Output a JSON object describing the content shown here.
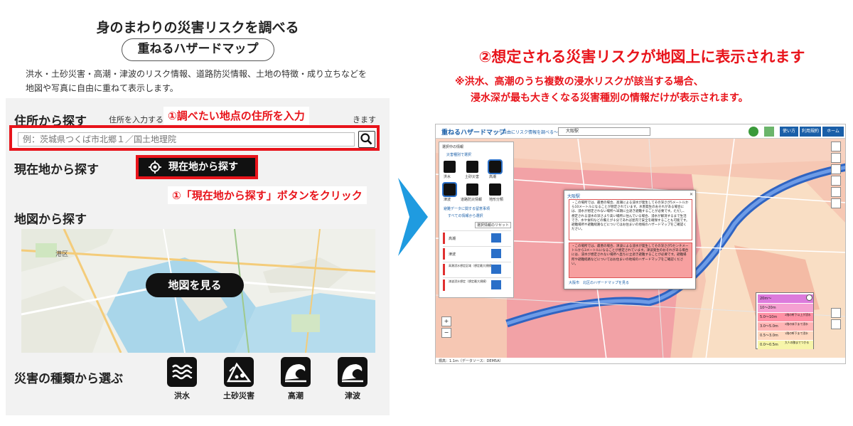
{
  "left": {
    "title": "身のまわりの災害リスクを調べる",
    "pill_label": "重ねるハザードマップ",
    "description": "洪水・土砂災害・高潮・津波のリスク情報、道路防災情報、土地の特徴・成り立ちなどを地図や写真に自由に重ねて表示します。",
    "search_section": {
      "heading": "住所から探す",
      "hint_prefix": "住所を入力する",
      "hint_suffix": "きます",
      "annotation": "①調べたい地点の住所を入力",
      "placeholder": "例：茨城県つくば市北郷１／国土地理院"
    },
    "current_section": {
      "heading": "現在地から探す",
      "button_label": "現在地から探す",
      "annotation": "①「現在地から探す」ボタンをクリック"
    },
    "map_section": {
      "heading": "地図から探す",
      "button_label": "地図を見る",
      "map_labels": {
        "a": "港区"
      }
    },
    "hazard_section": {
      "heading": "災害の種類から選ぶ",
      "items": [
        {
          "label": "洪水",
          "icon": "flood-icon"
        },
        {
          "label": "土砂災害",
          "icon": "landslide-icon"
        },
        {
          "label": "高潮",
          "icon": "storm-surge-icon"
        },
        {
          "label": "津波",
          "icon": "tsunami-icon"
        }
      ]
    }
  },
  "right": {
    "title": "②想定される災害リスクが地図上に表示されます",
    "note_line1": "※洪水、高潮のうち複数の浸水リスクが該当する場合、",
    "note_line2": "浸水深が最も大きくなる災害種別の情報だけが表示されます。",
    "screenshot": {
      "logo": "重ねるハザードマップ",
      "tagline": "～自由にリスク情報を調べる～",
      "search_value": "大阪駅",
      "header_buttons": [
        "使い方",
        "利用規約",
        "ホーム"
      ],
      "side": {
        "title": "選択中の情報",
        "type_select": "災害種別で選択",
        "hazards": [
          "洪水",
          "土砂災害",
          "高潮",
          "津波",
          "道路防災情報",
          "地形分類"
        ],
        "link1": "避難データに関する留意事項",
        "link2": "すべての情報から選択",
        "reset": "選択情報のリセット",
        "rows": [
          "高潮",
          "津波",
          "高潮浸水想定区域（想定最大規模）",
          "津波浸水想定（想定最大規模）"
        ]
      },
      "popup": {
        "title": "大阪駅",
        "block1": "・この場所では、最悪の場合、高潮による浸水が発生してその深さが5メートルから10メートルになることが想定されています。水害発生のおそれがある場合には、浸水が想定されない場所へ早期に立退き避難することが必要です。ただし、想定される浸水の深さより高い場所に住んでいる場合、浸水が解消するまで生活でき、水や食料などの備えが十分であれば屋内で安全を確保することも可能です。避難場所や避難経路などについてはお住まいの地域のハザードマップをご確認ください。",
        "block2": "・この場所では、最悪の場合、津波による浸水が発生してその深さが5センチメートルから3メートルになることが想定されています。津波発生のおそれがある場合には、浸水が想定されない場所へ直ちに立退き避難することが必要です。避難場所や避難経路などについてはお住まいの地域のハザードマップをご確認ください。",
        "link": "大阪市　北区のハザードマップを見る"
      },
      "legend": [
        "20m～",
        "10～20m",
        "5.0～10m",
        "3.0～5.0m",
        "0.5～3.0m",
        "0.0～0.5m"
      ],
      "legend_notes": [
        "2階の軒下以上が浸水",
        "2階の床下まで浸水",
        "1階の軒下まで浸水",
        "大人の膝までつかる"
      ],
      "zoom": [
        "+",
        "−"
      ],
      "footer": "標高：1.1m（データソース：DEM5A）",
      "legend_colors": [
        "#dc7adc",
        "#f5a0d2",
        "#ff91a5",
        "#ffb4b4",
        "#ffd8c0",
        "#f7f5a9"
      ]
    }
  },
  "colors": {
    "accent_red": "#e8141b",
    "arrow_blue": "#1f9be0",
    "gsi_blue": "#1a5fa8"
  }
}
